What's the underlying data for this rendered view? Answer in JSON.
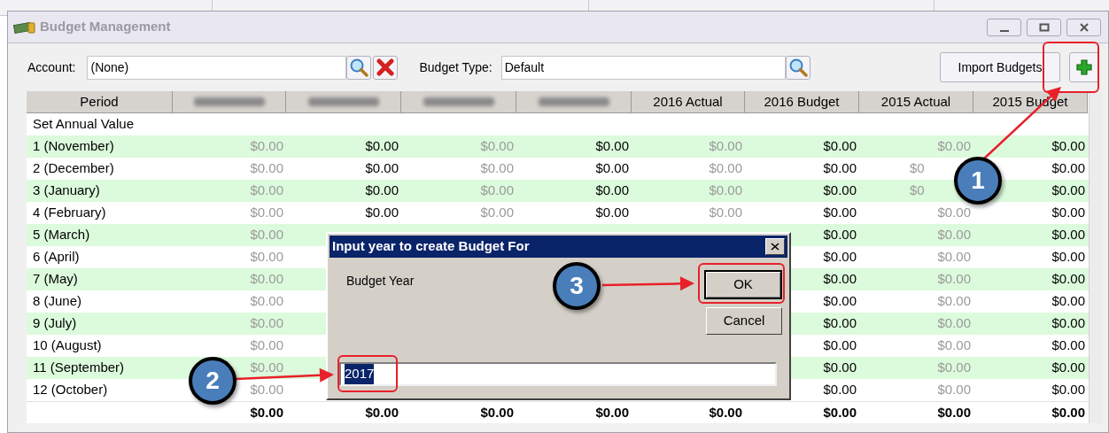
{
  "window": {
    "title": "Budget Management"
  },
  "toolbar": {
    "account_label": "Account:",
    "account_value": "(None)",
    "budget_type_label": "Budget Type:",
    "budget_type_value": "Default",
    "import_button": "Import Budgets"
  },
  "table": {
    "columns": [
      {
        "kind": "text",
        "label": "Period",
        "muted": false
      },
      {
        "kind": "blurred",
        "muted": true
      },
      {
        "kind": "blurred",
        "muted": false
      },
      {
        "kind": "blurred",
        "muted": true
      },
      {
        "kind": "blurred",
        "muted": false
      },
      {
        "kind": "text",
        "label": "2016 Actual",
        "muted": true
      },
      {
        "kind": "text",
        "label": "2016 Budget",
        "muted": false
      },
      {
        "kind": "text",
        "label": "2015 Actual",
        "muted": true
      },
      {
        "kind": "text",
        "label": "2015 Budget",
        "muted": false
      }
    ],
    "rows": [
      {
        "label": "Set Annual Value",
        "highlighted": false,
        "total": false
      },
      {
        "label": "1 (November)",
        "highlighted": true,
        "total": false,
        "cells": [
          "$0.00",
          "$0.00",
          "$0.00",
          "$0.00",
          "$0.00",
          "$0.00",
          "$0.00",
          "$0.00"
        ]
      },
      {
        "label": "2 (December)",
        "highlighted": false,
        "total": false,
        "cells": [
          "$0.00",
          "$0.00",
          "$0.00",
          "$0.00",
          "$0.00",
          "$0.00",
          "$0",
          "$0.00"
        ]
      },
      {
        "label": "3 (January)",
        "highlighted": true,
        "total": false,
        "cells": [
          "$0.00",
          "$0.00",
          "$0.00",
          "$0.00",
          "$0.00",
          "$0.00",
          "$0",
          "$0.00"
        ]
      },
      {
        "label": "4 (February)",
        "highlighted": false,
        "total": false,
        "cells": [
          "$0.00",
          "$0.00",
          "$0.00",
          "$0.00",
          "$0.00",
          "$0.00",
          "$0.00",
          "$0.00"
        ]
      },
      {
        "label": "5 (March)",
        "highlighted": true,
        "total": false,
        "cells": [
          "$0.00",
          null,
          null,
          null,
          null,
          "$0.00",
          "$0.00",
          "$0.00"
        ]
      },
      {
        "label": "6 (April)",
        "highlighted": false,
        "total": false,
        "cells": [
          "$0.00",
          null,
          null,
          null,
          null,
          "$0.00",
          "$0.00",
          "$0.00"
        ]
      },
      {
        "label": "7 (May)",
        "highlighted": true,
        "total": false,
        "cells": [
          "$0.00",
          null,
          null,
          null,
          null,
          "$0.00",
          "$0.00",
          "$0.00"
        ]
      },
      {
        "label": "8 (June)",
        "highlighted": false,
        "total": false,
        "cells": [
          "$0.00",
          null,
          null,
          null,
          null,
          "$0.00",
          "$0.00",
          "$0.00"
        ]
      },
      {
        "label": "9 (July)",
        "highlighted": true,
        "total": false,
        "cells": [
          "$0.00",
          null,
          null,
          null,
          null,
          "$0.00",
          "$0.00",
          "$0.00"
        ]
      },
      {
        "label": "10 (August)",
        "highlighted": false,
        "total": false,
        "cells": [
          "$0.00",
          null,
          null,
          null,
          null,
          "$0.00",
          "$0.00",
          "$0.00"
        ]
      },
      {
        "label": "11 (September)",
        "highlighted": true,
        "total": false,
        "cells": [
          "$0.00",
          null,
          null,
          null,
          null,
          "$0.00",
          "$0.00",
          "$0.00"
        ]
      },
      {
        "label": "12 (October)",
        "highlighted": false,
        "total": false,
        "cells": [
          "$0.00",
          null,
          null,
          null,
          null,
          "$0.00",
          "$0.00",
          "$0.00"
        ]
      },
      {
        "total": true,
        "highlighted": false,
        "cells": [
          "$0.00",
          "$0.00",
          "$0.00",
          "$0.00",
          "$0.00",
          "$0.00",
          "$0.00",
          "$0.00"
        ]
      }
    ]
  },
  "dialog": {
    "title": "Input year to create Budget For",
    "label": "Budget Year",
    "ok": "OK",
    "cancel": "Cancel",
    "value": "2017",
    "value_selected": true
  },
  "callouts": [
    {
      "number": "1"
    },
    {
      "number": "2"
    },
    {
      "number": "3"
    }
  ]
}
